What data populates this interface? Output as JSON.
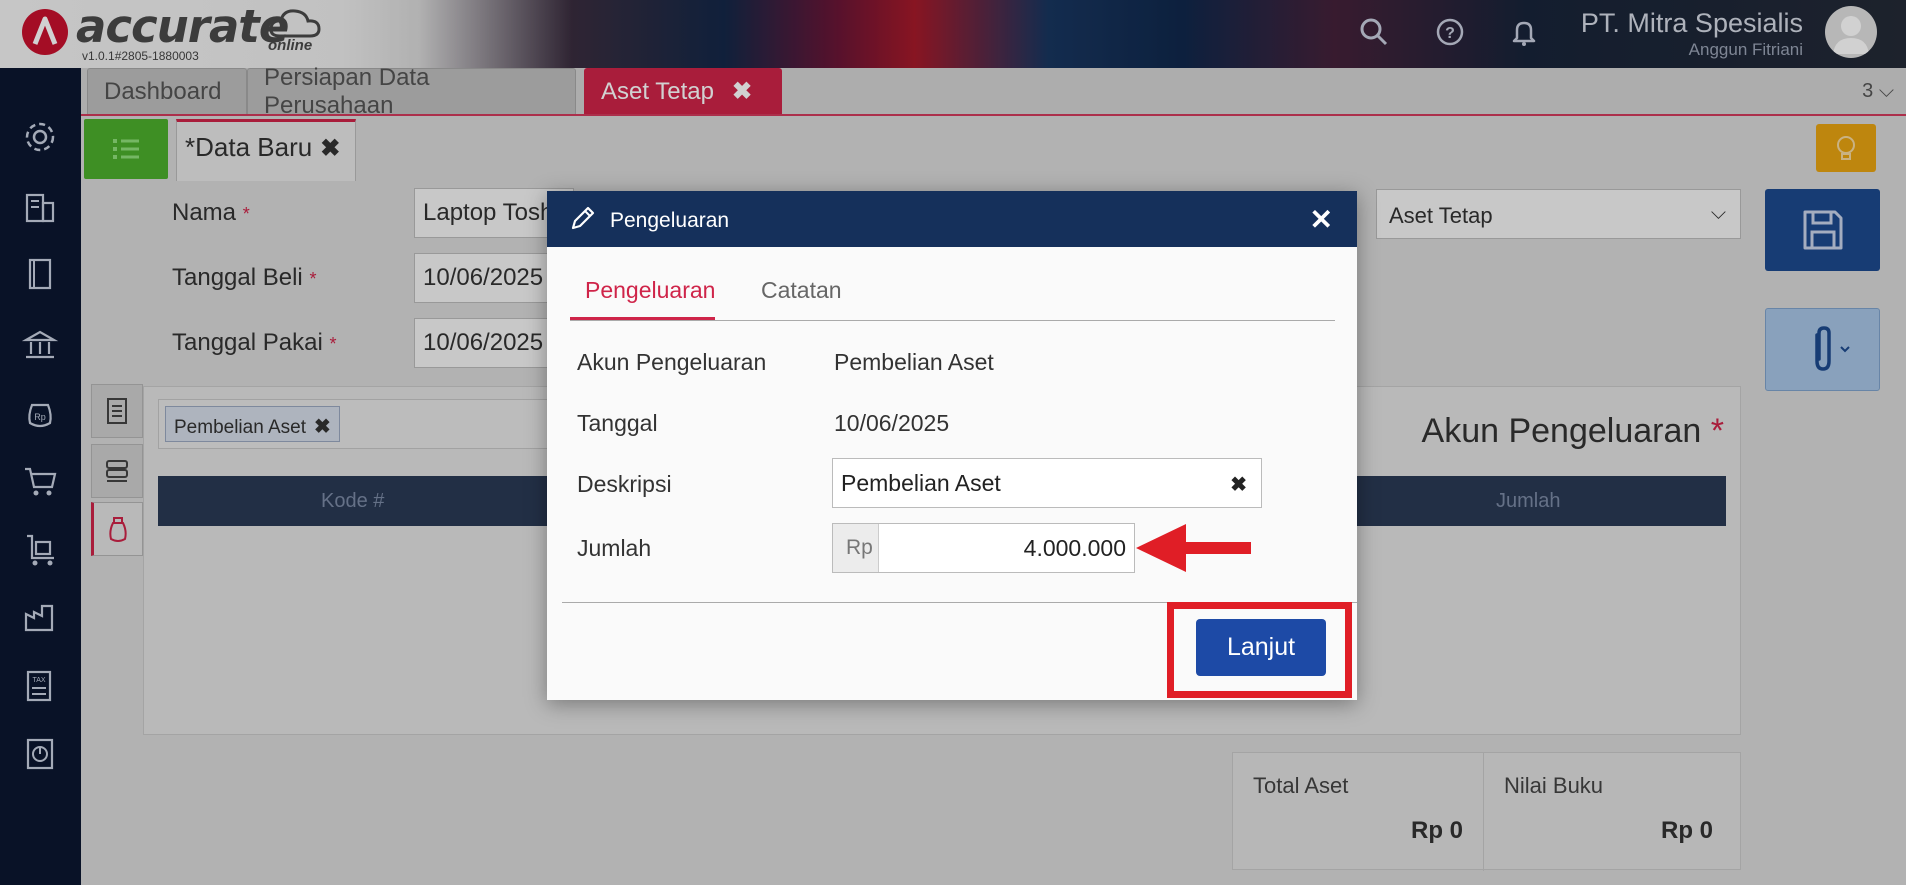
{
  "header": {
    "logo_text": "accurate",
    "logo_sub": "online",
    "version": "v1.0.1#2805-1880003",
    "company_name": "PT. Mitra Spesialis",
    "user_name": "Anggun Fitriani"
  },
  "tabs": [
    {
      "label": "Dashboard"
    },
    {
      "label": "Persiapan Data Perusahaan"
    },
    {
      "label": "Aset Tetap",
      "close": "✖"
    }
  ],
  "tab_count": "3 ⌵",
  "subtab": {
    "label": "*Data Baru",
    "close": "✖"
  },
  "form": {
    "nama_label": "Nama",
    "nama_value": "Laptop Toshiba",
    "tgl_beli_label": "Tanggal Beli",
    "tgl_beli_value": "10/06/2025",
    "tgl_pakai_label": "Tanggal Pakai",
    "tgl_pakai_value": "10/06/2025",
    "required_mark": "*",
    "kategori_value": "Aset Tetap"
  },
  "panel": {
    "chip_label": "Pembelian Aset",
    "chip_close": "✖",
    "akun_title": "Akun Pengeluaran",
    "col_kode": "Kode #",
    "col_jumlah": "Jumlah"
  },
  "totals": {
    "total_aset_label": "Total Aset",
    "total_aset_value": "Rp 0",
    "nilai_buku_label": "Nilai Buku",
    "nilai_buku_value": "Rp 0"
  },
  "dialog": {
    "title": "Pengeluaran",
    "close": "✕",
    "tab_active": "Pengeluaran",
    "tab_inactive": "Catatan",
    "akun_label": "Akun Pengeluaran",
    "akun_value": "Pembelian Aset",
    "tanggal_label": "Tanggal",
    "tanggal_value": "10/06/2025",
    "deskripsi_label": "Deskripsi",
    "deskripsi_value": "Pembelian Aset",
    "deskripsi_clear": "✖",
    "jumlah_label": "Jumlah",
    "currency": "Rp",
    "jumlah_value": "4.000.000",
    "lanjut_label": "Lanjut"
  },
  "colors": {
    "accent": "#cf2449",
    "dialog_header": "#15305b",
    "primary_button": "#1d4aa6",
    "annotation": "#e01e26"
  }
}
